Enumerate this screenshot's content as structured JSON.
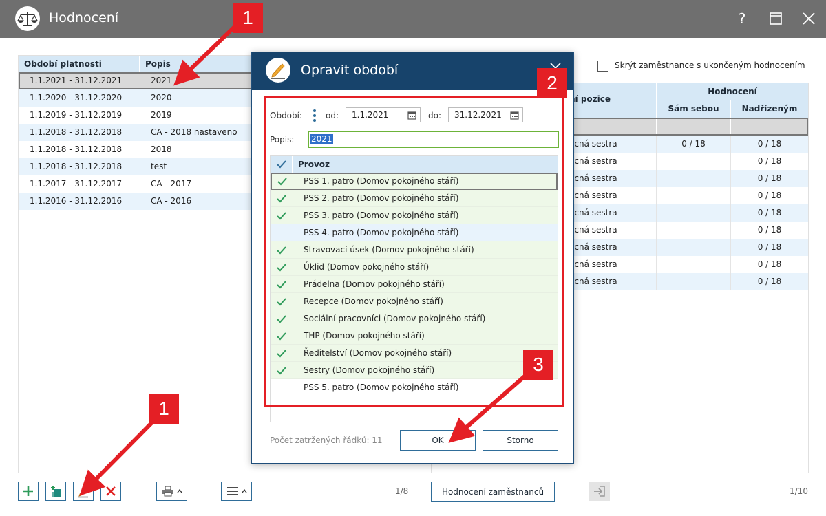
{
  "window": {
    "title": "Hodnocení"
  },
  "left_table": {
    "columns": [
      "Období platnosti",
      "Popis"
    ],
    "rows": [
      {
        "period": "1.1.2021 - 31.12.2021",
        "desc": "2021"
      },
      {
        "period": "1.1.2020 - 31.12.2020",
        "desc": "2020"
      },
      {
        "period": "1.1.2019 - 31.12.2019",
        "desc": "2019"
      },
      {
        "period": "1.1.2018 - 31.12.2018",
        "desc": "CA - 2018 nastaveno"
      },
      {
        "period": "1.1.2018 - 31.12.2018",
        "desc": "2018"
      },
      {
        "period": "1.1.2018 - 31.12.2018",
        "desc": "test"
      },
      {
        "period": "1.1.2017 - 31.12.2017",
        "desc": "CA - 2017"
      },
      {
        "period": "1.1.2016 - 31.12.2016",
        "desc": "CA - 2016"
      }
    ],
    "pager": "1/8"
  },
  "right_panel": {
    "hide_label": "Skrýt zaměstnance s ukončeným hodnocením",
    "headers": {
      "position": "ní pozice",
      "rating": "Hodnocení",
      "self": "Sám sebou",
      "superior": "Nadřízeným"
    },
    "rows": [
      {
        "position": "ecná sestra",
        "self": "0 / 18",
        "superior": "0 / 18"
      },
      {
        "position": "ecná sestra",
        "self": "",
        "superior": "0 / 18"
      },
      {
        "position": "ecná sestra",
        "self": "",
        "superior": "0 / 18"
      },
      {
        "position": "ecná sestra",
        "self": "",
        "superior": "0 / 18"
      },
      {
        "position": "ecná sestra",
        "self": "",
        "superior": "0 / 18"
      },
      {
        "position": "ecná sestra",
        "self": "",
        "superior": "0 / 18"
      },
      {
        "position": "ecná sestra",
        "self": "",
        "superior": "0 / 18"
      },
      {
        "position": "ecná sestra",
        "self": "",
        "superior": "0 / 18"
      },
      {
        "position": "ecná sestra",
        "self": "",
        "superior": "0 / 18"
      }
    ],
    "employee_button": "Hodnocení zaměstnanců",
    "pager": "1/10"
  },
  "dialog": {
    "title": "Opravit období",
    "period_label": "Období:",
    "from_label": "od:",
    "from_value": "1.1.2021",
    "to_label": "do:",
    "to_value": "31.12.2021",
    "desc_label": "Popis:",
    "desc_value": "2021",
    "grid_header": "Provoz",
    "rows": [
      {
        "name": "PSS 1. patro (Domov pokojného stáří)",
        "checked": true
      },
      {
        "name": "PSS 2. patro (Domov pokojného stáří)",
        "checked": true
      },
      {
        "name": "PSS 3. patro (Domov pokojného stáří)",
        "checked": true
      },
      {
        "name": "PSS 4. patro (Domov pokojného stáří)",
        "checked": false
      },
      {
        "name": "Stravovací úsek (Domov pokojného stáří)",
        "checked": true
      },
      {
        "name": "Úklid (Domov pokojného stáří)",
        "checked": true
      },
      {
        "name": "Prádelna (Domov pokojného stáří)",
        "checked": true
      },
      {
        "name": "Recepce (Domov pokojného stáří)",
        "checked": true
      },
      {
        "name": "Sociální pracovníci (Domov pokojného stáří)",
        "checked": true
      },
      {
        "name": "THP (Domov pokojného stáří)",
        "checked": true
      },
      {
        "name": "Ředitelství (Domov pokojného stáří)",
        "checked": true
      },
      {
        "name": "Sestry (Domov pokojného stáří)",
        "checked": true
      },
      {
        "name": "PSS 5. patro (Domov pokojného stáří)",
        "checked": false
      }
    ],
    "count_label": "Počet zatržených řádků: 11",
    "ok": "OK",
    "cancel": "Storno"
  },
  "annotations": {
    "badge1": "1",
    "badge2": "2",
    "badge3": "3",
    "badge1b": "1"
  },
  "colors": {
    "accent": "#2f6d99",
    "check": "#2e9b5a",
    "annotation": "#e41f25",
    "dialog_header": "#17436b"
  }
}
